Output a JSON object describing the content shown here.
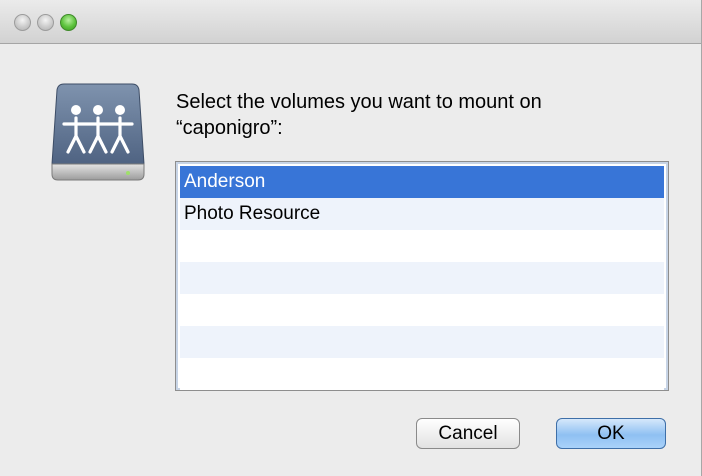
{
  "window": {
    "controls": [
      "close-button",
      "minimize-button",
      "zoom-button"
    ]
  },
  "dialog": {
    "icon": "network-server-icon",
    "prompt": "Select the volumes you want to mount on “caponigro”:"
  },
  "volumes": {
    "items": [
      "Anderson",
      "Photo Resource"
    ],
    "selected": "Anderson"
  },
  "buttons": {
    "cancel_label": "Cancel",
    "ok_label": "OK"
  },
  "colors": {
    "selection": "#3875d7",
    "alternate_row": "#eef3fb",
    "window_background": "#ececec"
  }
}
